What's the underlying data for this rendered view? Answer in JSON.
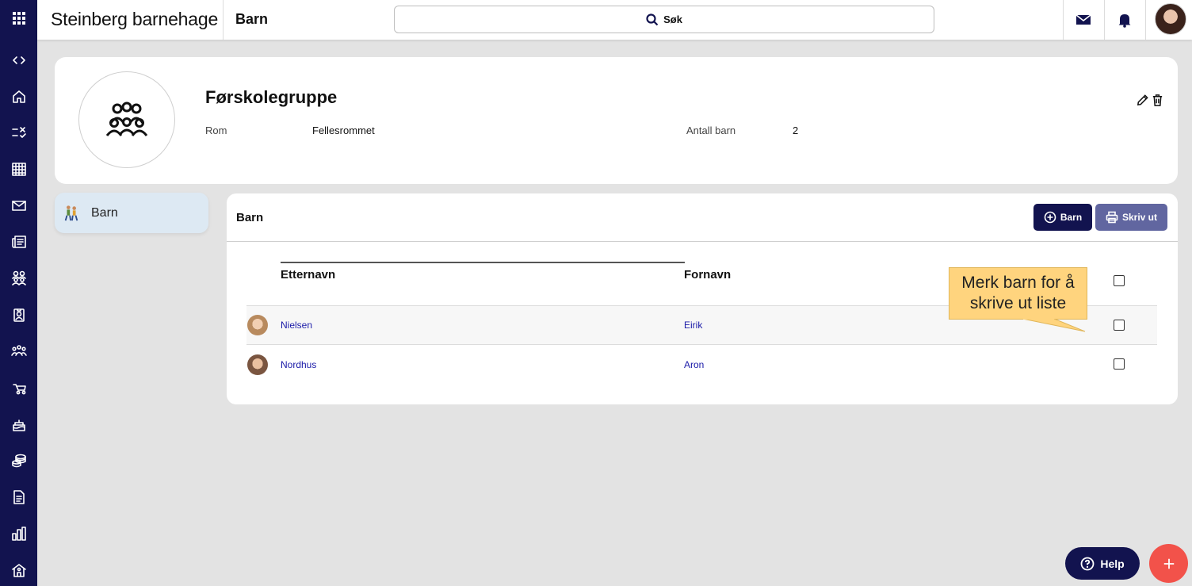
{
  "topbar": {
    "org_name": "Steinberg barnehage",
    "page": "Barn",
    "search_label": "Søk",
    "icons": [
      "apps-grid-icon",
      "mail-icon",
      "bell-icon"
    ]
  },
  "rail": {
    "icons": [
      "collapse-toggle-icon",
      "home-icon",
      "tasks-icon",
      "calendar-icon",
      "mail-icon",
      "news-icon",
      "groups-icon",
      "badge-icon",
      "children-icon",
      "stroller-icon",
      "birthday-icon",
      "coins-icon",
      "document-icon",
      "stats-icon",
      "kindergarten-icon"
    ]
  },
  "group": {
    "title": "Førskolegruppe",
    "room_label": "Rom",
    "room_value": "Fellesrommet",
    "count_label": "Antall barn",
    "count_value": "2"
  },
  "side_tab": {
    "label": "Barn"
  },
  "list": {
    "title": "Barn",
    "add_button": "Barn",
    "print_button": "Skriv ut",
    "columns": {
      "lastname": "Etternavn",
      "firstname": "Fornavn"
    },
    "rows": [
      {
        "lastname": "Nielsen",
        "firstname": "Eirik"
      },
      {
        "lastname": "Nordhus",
        "firstname": "Aron"
      }
    ]
  },
  "callout": {
    "line1": "Merk barn for å",
    "line2": "skrive ut liste"
  },
  "help": {
    "label": "Help"
  },
  "colors": {
    "navy": "#12134f",
    "print": "#6166a0",
    "fab": "#f2524a",
    "callout": "#ffd47e"
  }
}
